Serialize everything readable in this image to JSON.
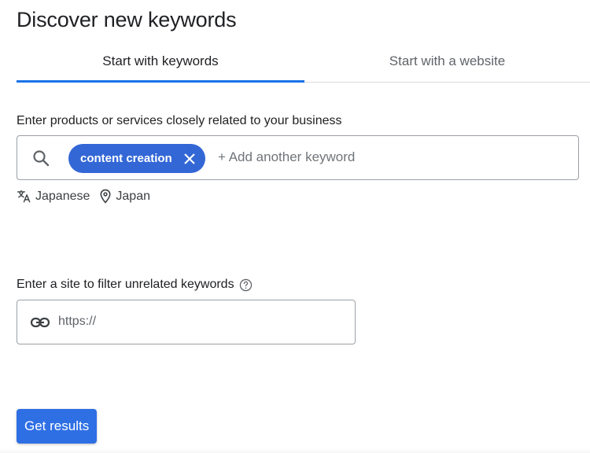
{
  "header": {
    "title": "Discover new keywords"
  },
  "tabs": [
    {
      "label": "Start with keywords",
      "active": true
    },
    {
      "label": "Start with a website",
      "active": false
    }
  ],
  "keywords_section": {
    "label": "Enter products or services closely related to your business",
    "chips": [
      {
        "label": "content creation"
      }
    ],
    "add_placeholder": "+ Add another keyword",
    "language": "Japanese",
    "location": "Japan"
  },
  "site_section": {
    "label": "Enter a site to filter unrelated keywords",
    "placeholder": "https://"
  },
  "actions": {
    "submit_label": "Get results"
  },
  "colors": {
    "accent": "#1a73e8",
    "chip": "#3367d6",
    "button": "#2f6fe4"
  },
  "icons": {
    "search": "search-icon",
    "chip_close": "close-icon",
    "language": "translate-icon",
    "location": "location-pin-icon",
    "help": "help-icon",
    "link": "link-icon"
  }
}
